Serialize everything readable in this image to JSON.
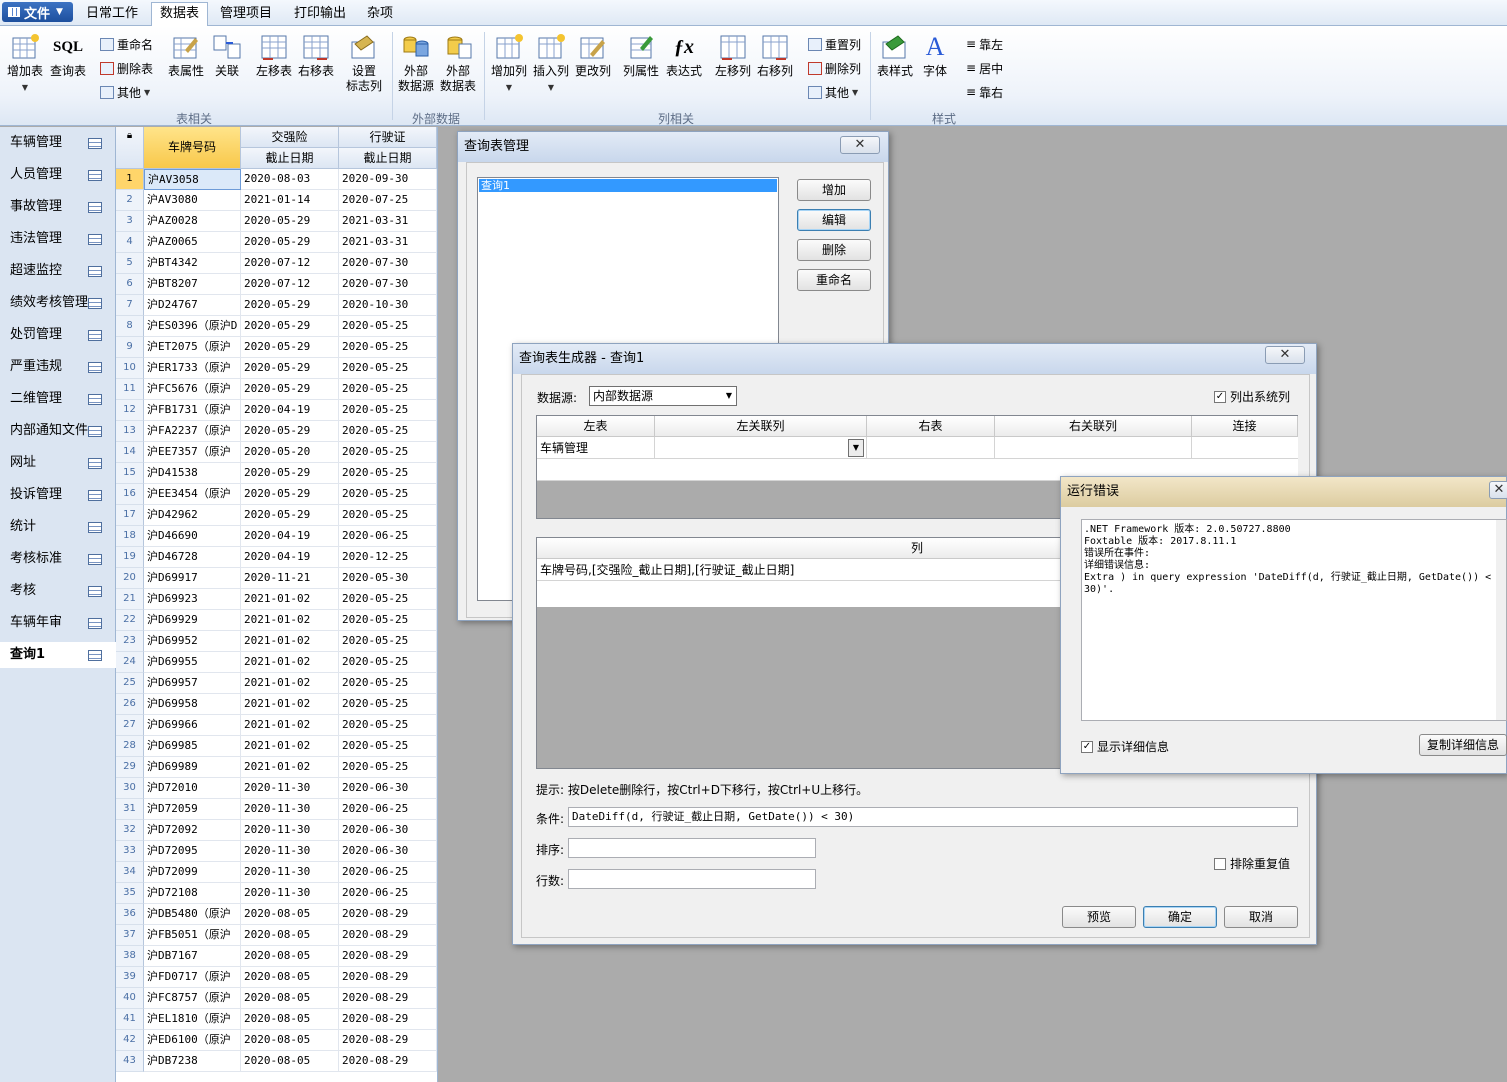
{
  "ribbon": {
    "file_label": "文件",
    "tabs": [
      "日常工作",
      "数据表",
      "管理项目",
      "打印输出",
      "杂项"
    ],
    "buttons": {
      "add_table": "增加表",
      "query_table": "查询表",
      "rename": "重命名",
      "delete_table": "删除表",
      "other": "其他",
      "table_props": "表属性",
      "relation": "关联",
      "move_table_left": "左移表",
      "move_table_right": "右移表",
      "set_flag_col_1": "设置",
      "set_flag_col_2": "标志列",
      "ext_source_1": "外部",
      "ext_source_2": "数据源",
      "ext_table_1": "外部",
      "ext_table_2": "数据表",
      "add_col": "增加列",
      "insert_col": "插入列",
      "change_col": "更改列",
      "col_props": "列属性",
      "expression": "表达式",
      "move_col_left": "左移列",
      "move_col_right": "右移列",
      "reset_col": "重置列",
      "delete_col": "删除列",
      "other2": "其他",
      "table_style": "表样式",
      "font": "字体",
      "align_left": "靠左",
      "align_center": "居中",
      "align_right": "靠右"
    },
    "groups": [
      "表相关",
      "外部数据",
      "列相关",
      "样式"
    ],
    "sql_label": "SQL"
  },
  "nav": {
    "items": [
      "车辆管理",
      "人员管理",
      "事故管理",
      "违法管理",
      "超速监控",
      "绩效考核管理",
      "处罚管理",
      "严重违规",
      "二维管理",
      "内部通知文件",
      "网址",
      "投诉管理",
      "统计",
      "考核标准",
      "考核",
      "车辆年审",
      "查询1"
    ],
    "active": "查询1"
  },
  "grid": {
    "headers": {
      "plate": "车牌号码",
      "insurance_1": "交强险",
      "insurance_2": "截止日期",
      "license_1": "行驶证",
      "license_2": "截止日期"
    },
    "rows": [
      [
        "1",
        "沪AV3058",
        "2020-08-03",
        "2020-09-30"
      ],
      [
        "2",
        "沪AV3080",
        "2021-01-14",
        "2020-07-25"
      ],
      [
        "3",
        "沪AZ0028",
        "2020-05-29",
        "2021-03-31"
      ],
      [
        "4",
        "沪AZ0065",
        "2020-05-29",
        "2021-03-31"
      ],
      [
        "5",
        "沪BT4342",
        "2020-07-12",
        "2020-07-30"
      ],
      [
        "6",
        "沪BT8207",
        "2020-07-12",
        "2020-07-30"
      ],
      [
        "7",
        "沪D24767",
        "2020-05-29",
        "2020-10-30"
      ],
      [
        "8",
        "沪ES0396（原沪D",
        "2020-05-29",
        "2020-05-25"
      ],
      [
        "9",
        "沪ET2075（原沪",
        "2020-05-29",
        "2020-05-25"
      ],
      [
        "10",
        "沪ER1733（原沪",
        "2020-05-29",
        "2020-05-25"
      ],
      [
        "11",
        "沪FC5676（原沪",
        "2020-05-29",
        "2020-05-25"
      ],
      [
        "12",
        "沪FB1731（原沪",
        "2020-04-19",
        "2020-05-25"
      ],
      [
        "13",
        "沪FA2237（原沪",
        "2020-05-29",
        "2020-05-25"
      ],
      [
        "14",
        "沪EE7357（原沪",
        "2020-05-20",
        "2020-05-25"
      ],
      [
        "15",
        "沪D41538",
        "2020-05-29",
        "2020-05-25"
      ],
      [
        "16",
        "沪EE3454（原沪",
        "2020-05-29",
        "2020-05-25"
      ],
      [
        "17",
        "沪D42962",
        "2020-05-29",
        "2020-05-25"
      ],
      [
        "18",
        "沪D46690",
        "2020-04-19",
        "2020-06-25"
      ],
      [
        "19",
        "沪D46728",
        "2020-04-19",
        "2020-12-25"
      ],
      [
        "20",
        "沪D69917",
        "2020-11-21",
        "2020-05-30"
      ],
      [
        "21",
        "沪D69923",
        "2021-01-02",
        "2020-05-25"
      ],
      [
        "22",
        "沪D69929",
        "2021-01-02",
        "2020-05-25"
      ],
      [
        "23",
        "沪D69952",
        "2021-01-02",
        "2020-05-25"
      ],
      [
        "24",
        "沪D69955",
        "2021-01-02",
        "2020-05-25"
      ],
      [
        "25",
        "沪D69957",
        "2021-01-02",
        "2020-05-25"
      ],
      [
        "26",
        "沪D69958",
        "2021-01-02",
        "2020-05-25"
      ],
      [
        "27",
        "沪D69966",
        "2021-01-02",
        "2020-05-25"
      ],
      [
        "28",
        "沪D69985",
        "2021-01-02",
        "2020-05-25"
      ],
      [
        "29",
        "沪D69989",
        "2021-01-02",
        "2020-05-25"
      ],
      [
        "30",
        "沪D72010",
        "2020-11-30",
        "2020-06-30"
      ],
      [
        "31",
        "沪D72059",
        "2020-11-30",
        "2020-06-25"
      ],
      [
        "32",
        "沪D72092",
        "2020-11-30",
        "2020-06-30"
      ],
      [
        "33",
        "沪D72095",
        "2020-11-30",
        "2020-06-30"
      ],
      [
        "34",
        "沪D72099",
        "2020-11-30",
        "2020-06-25"
      ],
      [
        "35",
        "沪D72108",
        "2020-11-30",
        "2020-06-25"
      ],
      [
        "36",
        "沪DB5480（原沪",
        "2020-08-05",
        "2020-08-29"
      ],
      [
        "37",
        "沪FB5051（原沪",
        "2020-08-05",
        "2020-08-29"
      ],
      [
        "38",
        "沪DB7167",
        "2020-08-05",
        "2020-08-29"
      ],
      [
        "39",
        "沪FD0717（原沪",
        "2020-08-05",
        "2020-08-29"
      ],
      [
        "40",
        "沪FC8757（原沪",
        "2020-08-05",
        "2020-08-29"
      ],
      [
        "41",
        "沪EL1810（原沪",
        "2020-08-05",
        "2020-08-29"
      ],
      [
        "42",
        "沪ED6100（原沪",
        "2020-08-05",
        "2020-08-29"
      ],
      [
        "43",
        "沪DB7238",
        "2020-08-05",
        "2020-08-29"
      ]
    ]
  },
  "query_mgr": {
    "title": "查询表管理",
    "list_items": [
      "查询1"
    ],
    "buttons": [
      "增加",
      "编辑",
      "删除",
      "重命名"
    ]
  },
  "builder": {
    "title": "查询表生成器 - 查询1",
    "datasource_label": "数据源:",
    "datasource_value": "内部数据源",
    "list_sys_cols": "列出系统列",
    "join_headers": [
      "左表",
      "左关联列",
      "右表",
      "右关联列",
      "连接"
    ],
    "join_row": [
      "车辆管理",
      "",
      "",
      "",
      ""
    ],
    "col_header": "列",
    "col_value": "车牌号码,[交强险_截止日期],[行驶证_截止日期]",
    "hint": "提示: 按Delete删除行，按Ctrl+D下移行，按Ctrl+U上移行。",
    "cond_label": "条件:",
    "cond_value": "DateDiff(d, 行驶证_截止日期, GetDate()) < 30)",
    "sort_label": "排序:",
    "sort_value": "",
    "rows_label": "行数:",
    "rows_value": "",
    "distinct": "排除重复值",
    "btn_preview": "预览",
    "btn_ok": "确定",
    "btn_cancel": "取消"
  },
  "error": {
    "title": "运行错误",
    "lines": [
      ".NET Framework 版本: 2.0.50727.8800",
      "Foxtable 版本: 2017.8.11.1",
      "错误所在事件:",
      "详细错误信息:",
      "Extra ) in query expression 'DateDiff(d, 行驶证_截止日期, GetDate()) < 30)'."
    ],
    "show_details": "显示详细信息",
    "copy_details": "复制详细信息"
  }
}
